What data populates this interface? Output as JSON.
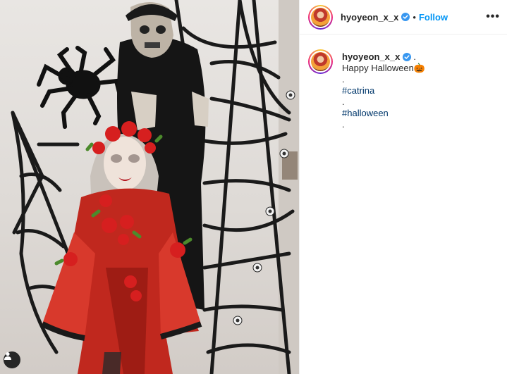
{
  "post": {
    "username": "hyoyeon_x_x",
    "separator": "•",
    "follow_label": "Follow",
    "more_label": "•••"
  },
  "caption": {
    "username": "hyoyeon_x_x",
    "trailing_dot": ".",
    "lines": [
      {
        "text": "Happy Halloween🎃",
        "type": "text"
      },
      {
        "text": ".",
        "type": "text"
      },
      {
        "text": "#catrina",
        "type": "hashtag"
      },
      {
        "text": ".",
        "type": "text"
      },
      {
        "text": "#halloween",
        "type": "hashtag"
      },
      {
        "text": ".",
        "type": "text"
      }
    ]
  },
  "icons": {
    "verified": "verified-badge-icon",
    "tag": "user-tag-icon"
  },
  "colors": {
    "accent": "#0095f6",
    "verified": "#3897f0",
    "hashtag": "#00376b",
    "text": "#262626",
    "dress": "#c0281e",
    "rose": "#d61f1f"
  }
}
